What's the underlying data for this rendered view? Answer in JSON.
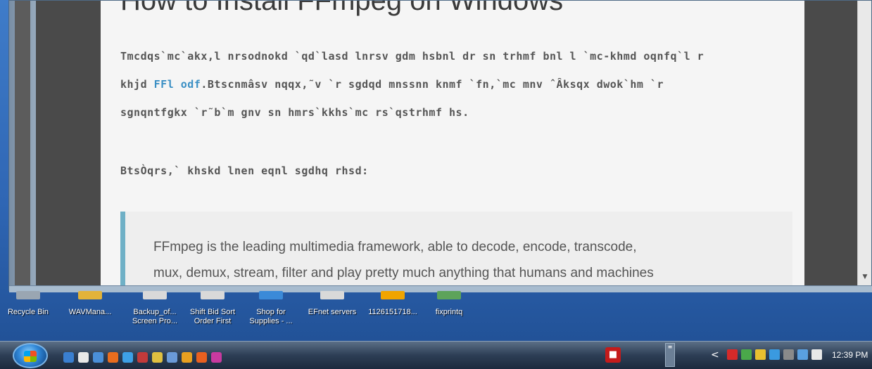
{
  "article": {
    "heading": "How to Install FFmpeg on Windows",
    "para1_line1": "Tmcdqs`mc`akx,l nrsodnokd `qd`lasd lnrsv gdm hsbnl dr sn trhmf bnl l `mc-khmd oqnfq`l r",
    "para1_line2_pre": "khjd ",
    "para1_line2_link": "FFl odf",
    "para1_line2_post": ".Btscnmâsv nqqx,˜v `r sgdqd mnssnn knmf `fn,`mc mnv ˆÂksqx dwok`hm `r",
    "para1_line3": "sgnqntfgkx `r˜b`m gnv sn hmrs`kkhs`mc rs`qstrhmf hs.",
    "para2": "BtsÒqrs,` khskd lnen eqnl sgdhq rhsd:",
    "quote_line1": "FFmpeg is the leading multimedia framework, able to decode, encode, transcode,",
    "quote_line2": "mux, demux, stream, filter and play pretty much anything that humans and machines"
  },
  "desktop_icons": [
    {
      "label1": "Recycle Bin",
      "label2": "",
      "icon": "recycle-bin-icon",
      "color": "#9aa6b2"
    },
    {
      "label1": "WAVMana...",
      "label2": "",
      "icon": "wav-manager-icon",
      "color": "#e2b33a"
    },
    {
      "label1": "Backup_of...",
      "label2": "Screen Pro...",
      "icon": "document-icon",
      "color": "#d9d9d9"
    },
    {
      "label1": "Shift Bid Sort",
      "label2": "Order First",
      "icon": "document-icon",
      "color": "#d9d9d9"
    },
    {
      "label1": "Shop for",
      "label2": "Supplies - ...",
      "icon": "shortcut-icon",
      "color": "#3b8ad8"
    },
    {
      "label1": "EFnet servers",
      "label2": "",
      "icon": "document-icon",
      "color": "#d9d9d9"
    },
    {
      "label1": "1126151718...",
      "label2": "",
      "icon": "image-icon",
      "color": "#f0a400"
    },
    {
      "label1": "fixprintq",
      "label2": "",
      "icon": "script-icon",
      "color": "#5da35a"
    }
  ],
  "taskbar": {
    "clock": "12:39 PM",
    "pdf_glyph": "■",
    "scroll_glyph": "≡",
    "tray_arrow": "<",
    "quicklaunch_colors": [
      "#3a7fd0",
      "#e8e8e8",
      "#4a8fd8",
      "#e86d1e",
      "#3da0e6",
      "#c23a3a",
      "#e0c040",
      "#6a9ad8",
      "#e8a020",
      "#e86020",
      "#c83aa0"
    ],
    "tray_colors": [
      "#d62a2a",
      "#4aa84a",
      "#e8c030",
      "#3a9ae0",
      "#8a8a8a",
      "#5aa0e0",
      "#e8e8e8"
    ]
  },
  "colors": {
    "link": "#3a8fc4",
    "quote_border": "#6fb0c6"
  }
}
